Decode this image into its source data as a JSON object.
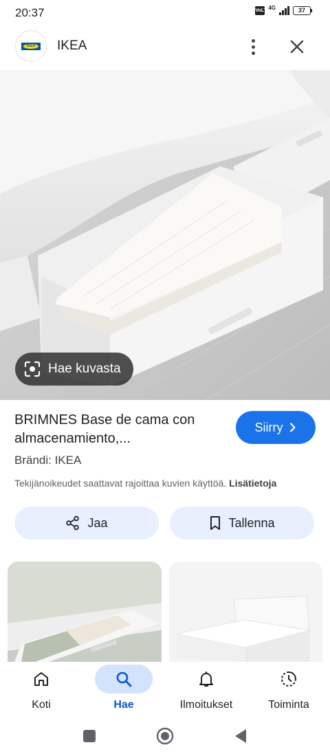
{
  "status_bar": {
    "time": "20:37",
    "network": "4G",
    "battery": "37"
  },
  "header": {
    "site_name": "IKEA",
    "logo_text": "IKEA"
  },
  "hero": {
    "lens_label": "Hae kuvasta"
  },
  "details": {
    "title": "BRIMNES Base de cama con almacenamiento,...",
    "visit_label": "Siirry",
    "brand": "Brändi: IKEA",
    "copyright_text": "Tekijänoikeudet saattavat rajoittaa kuvien käyttöä.",
    "more_info_link": "Lisätietoja",
    "share_label": "Jaa",
    "save_label": "Tallenna"
  },
  "bottom_nav": {
    "items": [
      {
        "label": "Koti",
        "icon": "home-icon"
      },
      {
        "label": "Hae",
        "icon": "search-icon",
        "active": true
      },
      {
        "label": "Ilmoitukset",
        "icon": "bell-icon"
      },
      {
        "label": "Toiminta",
        "icon": "activity-icon"
      }
    ]
  },
  "colors": {
    "accent": "#1a73e8",
    "button_bg": "#e8f0fe",
    "active_nav_bg": "#d3e3fd"
  }
}
